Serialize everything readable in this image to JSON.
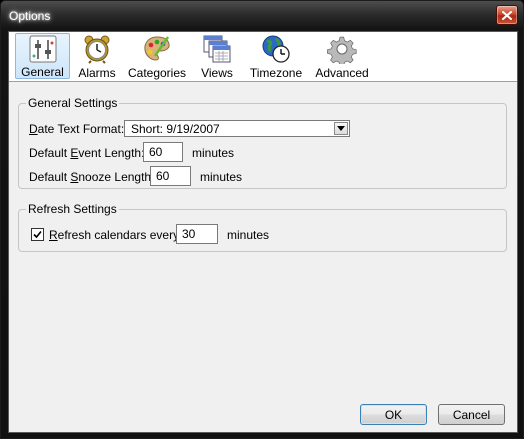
{
  "window": {
    "title": "Options",
    "close_icon": "close-x-icon"
  },
  "toolbar": {
    "items": [
      {
        "label": "General",
        "icon": "settings-sliders-icon",
        "selected": true
      },
      {
        "label": "Alarms",
        "icon": "alarm-clock-icon",
        "selected": false
      },
      {
        "label": "Categories",
        "icon": "paint-palette-icon",
        "selected": false
      },
      {
        "label": "Views",
        "icon": "calendar-views-icon",
        "selected": false
      },
      {
        "label": "Timezone",
        "icon": "globe-clock-icon",
        "selected": false
      },
      {
        "label": "Advanced",
        "icon": "gear-icon",
        "selected": false
      }
    ]
  },
  "general_settings": {
    "title": "General Settings",
    "date_format": {
      "label_pre": "",
      "label_ul": "D",
      "label_post": "ate Text Format:",
      "value": "Short: 9/19/2007"
    },
    "event_length": {
      "label_pre": "Default ",
      "label_ul": "E",
      "label_post": "vent Length:",
      "value": "60",
      "unit": "minutes"
    },
    "snooze_length": {
      "label_pre": "Default ",
      "label_ul": "S",
      "label_post": "nooze Length:",
      "value": "60",
      "unit": "minutes"
    }
  },
  "refresh_settings": {
    "title": "Refresh Settings",
    "refresh": {
      "checked": true,
      "label_pre": "",
      "label_ul": "R",
      "label_post": "efresh calendars every",
      "value": "30",
      "unit": "minutes"
    }
  },
  "buttons": {
    "ok": "OK",
    "cancel": "Cancel"
  },
  "colors": {
    "accent_selected": "#cde5fa",
    "close_button": "#c94a30"
  }
}
